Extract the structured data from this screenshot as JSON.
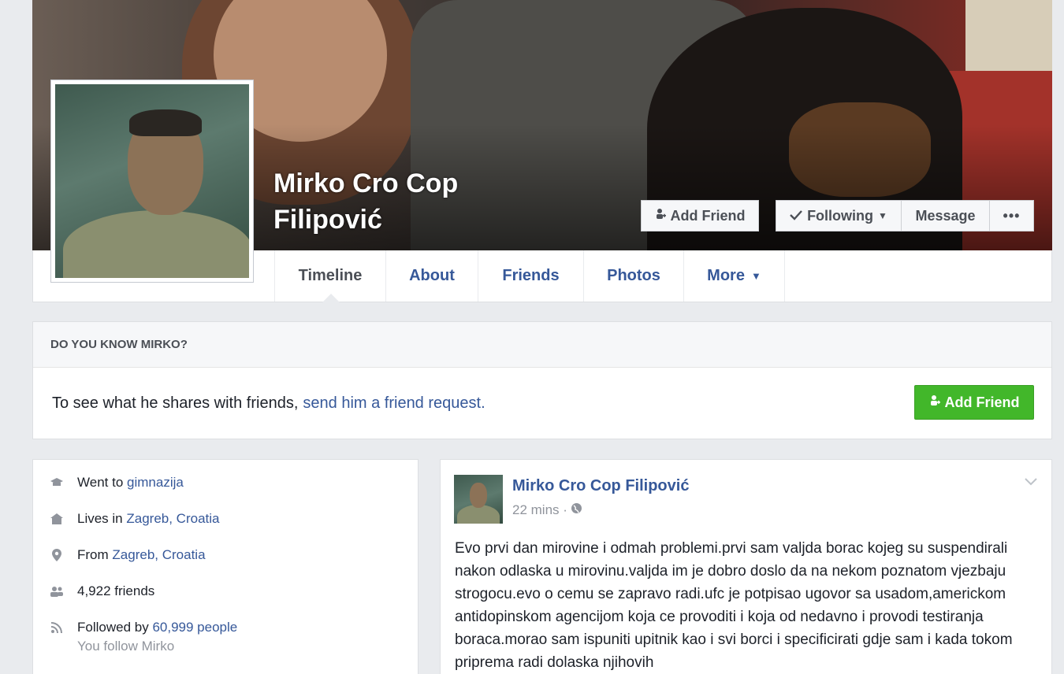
{
  "profile": {
    "name_line1": "Mirko Cro Cop",
    "name_line2": "Filipović"
  },
  "cover_actions": {
    "add_friend": "Add Friend",
    "following": "Following",
    "message": "Message",
    "more": "•••"
  },
  "nav": {
    "tabs": [
      {
        "label": "Timeline"
      },
      {
        "label": "About"
      },
      {
        "label": "Friends"
      },
      {
        "label": "Photos"
      },
      {
        "label": "More"
      }
    ]
  },
  "know_card": {
    "header": "DO YOU KNOW MIRKO?",
    "text": "To see what he shares with friends,",
    "link": "send him a friend request.",
    "button": "Add Friend"
  },
  "intro": {
    "went_prefix": "Went to",
    "went_link": "gimnazija",
    "lives_prefix": "Lives in",
    "lives_link": "Zagreb, Croatia",
    "from_prefix": "From",
    "from_link": "Zagreb, Croatia",
    "friends": "4,922 friends",
    "followed_prefix": "Followed by",
    "followed_link": "60,999 people",
    "you_follow": "You follow Mirko"
  },
  "post": {
    "author": "Mirko Cro Cop Filipović",
    "time": "22 mins ·",
    "text": "Evo prvi dan mirovine i odmah problemi.prvi sam valjda borac kojeg su suspendirali nakon odlaska u mirovinu.valjda im je dobro doslo da na nekom poznatom vjezbaju strogocu.evo o cemu se zapravo radi.ufc je potpisao ugovor sa usadom,americkom antidopinskom agencijom koja ce provoditi i koja od nedavno i provodi testiranja boraca.morao sam ispuniti upitnik kao i svi borci i specificirati gdje sam i kada tokom priprema radi dolaska njihovih"
  }
}
